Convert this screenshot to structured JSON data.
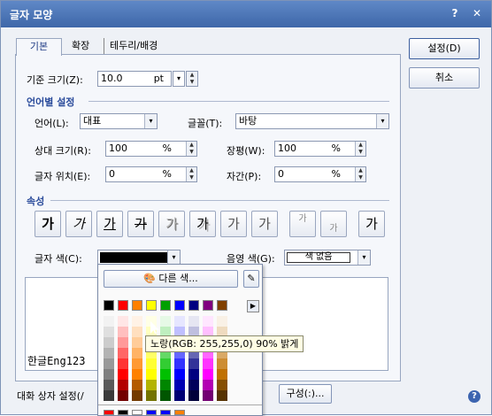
{
  "dialog": {
    "title": "글자 모양",
    "help": "?",
    "close": "✕"
  },
  "tabs": [
    {
      "label": "기본"
    },
    {
      "label": "확장"
    },
    {
      "label": "테두리/배경"
    }
  ],
  "base_size": {
    "label": "기준 크기(Z):",
    "value": "10.0",
    "unit": "pt"
  },
  "lang_section": "언어별 설정",
  "language": {
    "label": "언어(L):",
    "value": "대표"
  },
  "font": {
    "label": "글꼴(T):",
    "value": "바탕"
  },
  "rel_size": {
    "label": "상대 크기(R):",
    "value": "100",
    "unit": "%"
  },
  "width": {
    "label": "장평(W):",
    "value": "100",
    "unit": "%"
  },
  "pos": {
    "label": "글자 위치(E):",
    "value": "0",
    "unit": "%"
  },
  "spacing": {
    "label": "자간(P):",
    "value": "0",
    "unit": "%"
  },
  "attr_section": "속성",
  "style_glyphs": [
    "가",
    "가",
    "가",
    "가",
    "가",
    "가",
    "가",
    "가",
    "가",
    "가",
    "가"
  ],
  "text_color": {
    "label": "글자 색(C):",
    "value": "#000000"
  },
  "shade_color": {
    "label": "음영 색(G):",
    "value": "색 없음"
  },
  "preview_text": "한글Eng123",
  "popup": {
    "other_colors": "다른 색...",
    "top_row": [
      "#000000",
      "#ff0000",
      "#ff8000",
      "#ffff00",
      "#00a000",
      "#0000ff",
      "#000080",
      "#800080",
      "#804000"
    ]
  },
  "tooltip": "노랑(RGB: 255,255,0) 90% 밝게",
  "buttons": {
    "ok": "설정(D)",
    "cancel": "취소",
    "compose": "구성(:)..."
  },
  "bottom_label": "대화 상자 설정(/"
}
